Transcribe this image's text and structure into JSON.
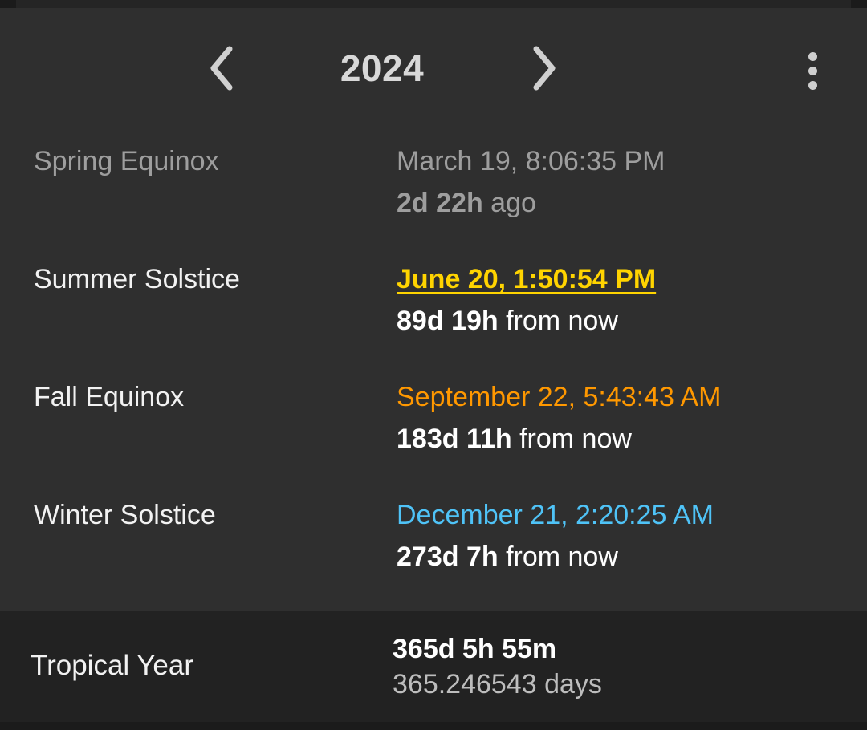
{
  "header": {
    "year": "2024",
    "prev_icon": "chevron-left-icon",
    "next_icon": "chevron-right-icon",
    "menu_icon": "more-vertical-icon"
  },
  "events": [
    {
      "label": "Spring Equinox",
      "date": "March 19, 8:06:35 PM",
      "relative_value": "2d 22h",
      "relative_suffix": "ago",
      "state": "past",
      "color": "#9e9e9e"
    },
    {
      "label": "Summer Solstice",
      "date": "June 20, 1:50:54 PM",
      "relative_value": "89d 19h",
      "relative_suffix": "from now",
      "state": "next",
      "color": "#ffd400"
    },
    {
      "label": "Fall Equinox",
      "date": "September 22, 5:43:43 AM",
      "relative_value": "183d 11h",
      "relative_suffix": "from now",
      "state": "future",
      "color": "#ff9800"
    },
    {
      "label": "Winter Solstice",
      "date": "December 21, 2:20:25 AM",
      "relative_value": "273d 7h",
      "relative_suffix": "from now",
      "state": "future",
      "color": "#4fc3f7"
    }
  ],
  "tropical_year": {
    "label": "Tropical Year",
    "duration": "365d 5h 55m",
    "days": "365.246543 days"
  }
}
